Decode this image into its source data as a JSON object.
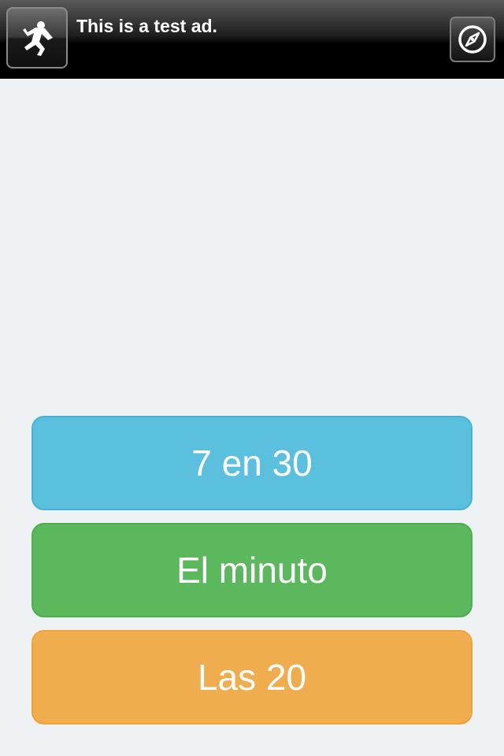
{
  "ad": {
    "text": "This is a test ad.",
    "icon": "running-figure-icon",
    "action_icon": "compass-icon"
  },
  "menu": {
    "buttons": [
      {
        "label": "7 en 30",
        "color": "#5bc0de"
      },
      {
        "label": "El minuto",
        "color": "#5cb85c"
      },
      {
        "label": "Las 20",
        "color": "#f0ad4e"
      }
    ]
  },
  "colors": {
    "background": "#eff2f5",
    "ad_background": "#000000"
  }
}
